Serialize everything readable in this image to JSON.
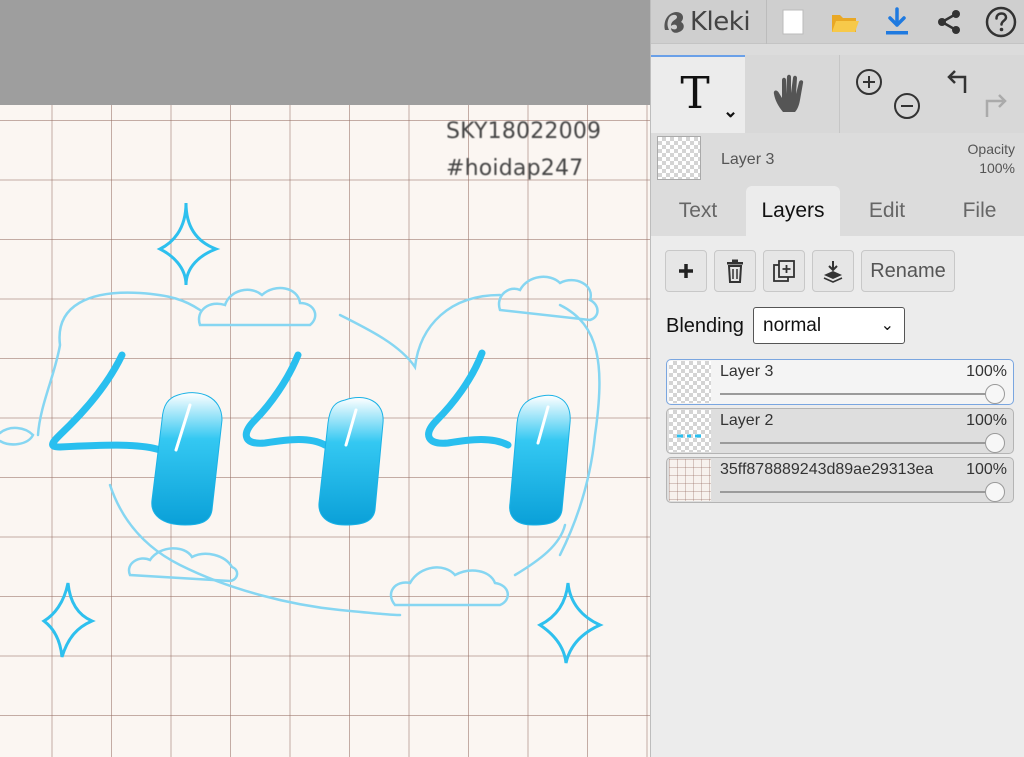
{
  "canvas": {
    "watermark_line1": "SKY18022009",
    "watermark_line2": "#hoidap247",
    "paper_color": "#fbf6f2",
    "ink_color": "#29bfef",
    "outline_color": "#7fd6f4"
  },
  "topbar": {
    "app_name": "Kleki",
    "icons": [
      "kleki-logo-icon",
      "new-document-icon",
      "open-folder-icon",
      "download-icon",
      "share-icon",
      "help-icon"
    ]
  },
  "tools": {
    "text_tool_glyph": "T",
    "dropdown_glyph": "⌄",
    "icons": [
      "text-tool-icon",
      "hand-icon",
      "zoom-in-icon",
      "zoom-out-icon",
      "undo-icon",
      "redo-icon"
    ]
  },
  "layer_preview": {
    "name": "Layer 3",
    "opacity_label": "Opacity",
    "opacity_value": "100%"
  },
  "tabs": [
    {
      "label": "Text",
      "active": false
    },
    {
      "label": "Layers",
      "active": true
    },
    {
      "label": "Edit",
      "active": false
    },
    {
      "label": "File",
      "active": false
    }
  ],
  "layers_panel": {
    "rename_label": "Rename",
    "blending_label": "Blending",
    "blending_value": "normal",
    "action_icons": [
      "add-layer-icon",
      "delete-layer-icon",
      "duplicate-layer-icon",
      "merge-down-icon"
    ],
    "layers": [
      {
        "name": "Layer 3",
        "opacity": "100%",
        "opacity_fraction": 1.0,
        "selected": true
      },
      {
        "name": "Layer 2",
        "opacity": "100%",
        "opacity_fraction": 1.0,
        "selected": false
      },
      {
        "name": "35ff878889243d89ae29313ea",
        "opacity": "100%",
        "opacity_fraction": 1.0,
        "selected": false
      }
    ]
  },
  "colors": {
    "accent": "#6aa0e8",
    "download_blue": "#1f7ae0",
    "folder_yellow": "#f2b531"
  }
}
